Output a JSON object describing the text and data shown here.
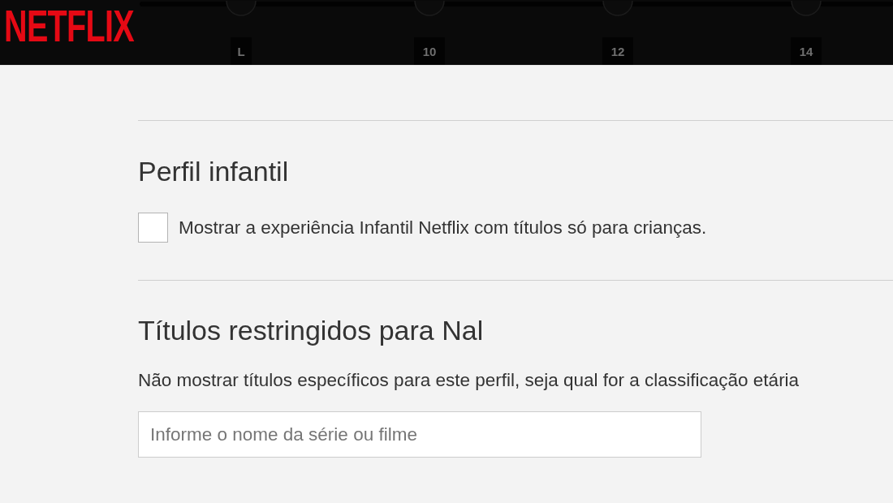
{
  "header": {
    "logo": "NETFLIX",
    "rating_slider": {
      "labels": [
        "L",
        "10",
        "12",
        "14"
      ]
    }
  },
  "sections": [
    {
      "kind": "checkbox",
      "title": "Perfil infantil",
      "checkbox": {
        "label": "Mostrar a experiência Infantil Netflix com títulos só para crianças.",
        "checked": false
      }
    },
    {
      "kind": "search",
      "title": "Títulos restringidos para Nal",
      "description": "Não mostrar títulos específicos para este perfil, seja qual for a classificação etária",
      "input": {
        "placeholder": "Informe o nome da série ou filme"
      }
    }
  ]
}
